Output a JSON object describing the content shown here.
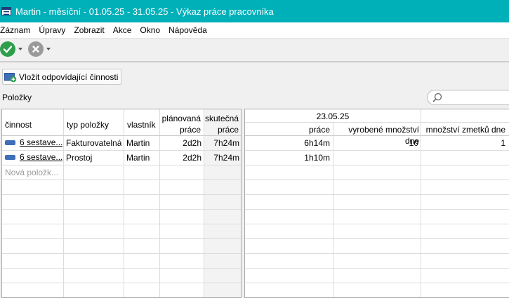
{
  "window": {
    "title": "Martin - měsíční - 01.05.25 - 31.05.25 - Výkaz práce pracovníka"
  },
  "menu": [
    "Záznam",
    "Úpravy",
    "Zobrazit",
    "Akce",
    "Okno",
    "Nápověda"
  ],
  "toolbar": {
    "confirm_icon": "check-circle-icon",
    "cancel_icon": "x-circle-icon"
  },
  "actions": {
    "insert_label": "Vložit odpovídající činnosti"
  },
  "section": {
    "label": "Položky",
    "search_value": ""
  },
  "colors": {
    "titlebar": "#00b0b9",
    "confirm": "#2e9e4a",
    "cancel": "#9a9a9a",
    "row_icon": "#3f6fb8"
  },
  "left_table": {
    "headers": {
      "cinnost": "činnost",
      "typ": "typ položky",
      "vlastnik": "vlastník",
      "planovana_1": "plánovaná",
      "planovana_2": "práce",
      "skutecna_1": "skutečná",
      "skutecna_2": "práce"
    },
    "rows": [
      {
        "cinnost": "6 sestave...",
        "typ": "Fakturovatelná",
        "vlastnik": "Martin",
        "planovana": "2d2h",
        "skutecna": "7h24m"
      },
      {
        "cinnost": "6 sestave...",
        "typ": "Prostoj",
        "vlastnik": "Martin",
        "planovana": "2d2h",
        "skutecna": "7h24m"
      }
    ],
    "new_row_placeholder": "Nová položk..."
  },
  "right_table": {
    "date": "23.05.25",
    "headers": {
      "prace": "práce",
      "vyrobene": "vyrobené množství dne",
      "zmetky": "množství zmetků dne"
    },
    "rows": [
      {
        "prace": "6h14m",
        "vyrobene": "10",
        "zmetky": "1"
      },
      {
        "prace": "1h10m",
        "vyrobene": "",
        "zmetky": ""
      }
    ]
  }
}
